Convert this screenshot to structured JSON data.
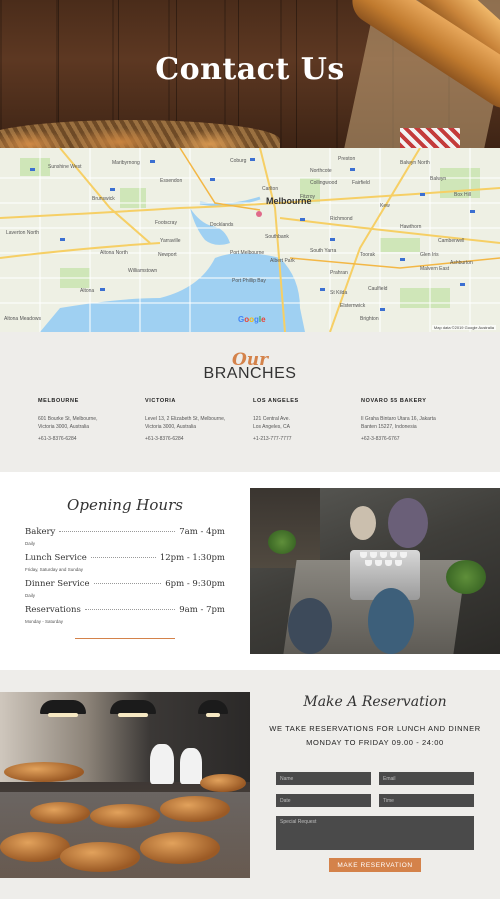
{
  "hero": {
    "title": "Contact Us"
  },
  "map": {
    "logo_letters": [
      "G",
      "o",
      "o",
      "g",
      "l",
      "e"
    ],
    "attribution": "Map data ©2019 Google   Australia",
    "city_label": "Melbourne",
    "labels": [
      "Sunshine West",
      "Maribyrnong",
      "Brunswick",
      "Northcote",
      "Fairfield",
      "Balwyn",
      "Kew",
      "Hawthorn",
      "Camberwell",
      "Richmond",
      "South Yarra",
      "Prahran",
      "St Kilda",
      "Brighton",
      "Williamstown",
      "Newport",
      "Altona North",
      "Footscray",
      "Port Melbourne",
      "Southbank",
      "Carlton",
      "Fitzroy",
      "Collingwood",
      "Toorak",
      "Malvern East",
      "Elsternwick",
      "Caulfield",
      "Glen Iris",
      "Ashburton",
      "Preston",
      "Coburg",
      "Essendon",
      "Yarraville",
      "Docklands",
      "Albert Park",
      "Port Phillip Bay",
      "Altona",
      "Laverton North",
      "Altona Meadows",
      "Balwyn North",
      "Box Hill"
    ]
  },
  "branches": {
    "heading_script": "Our",
    "heading_word": "BRANCHES",
    "items": [
      {
        "name": "MELBOURNE",
        "address_1": "601 Bourke St, Melbourne,",
        "address_2": "Victoria 3000, Australia",
        "phone": "+61-3-8376-6284"
      },
      {
        "name": "VICTORIA",
        "address_1": "Level 13, 2 Elizabeth St, Melbourne,",
        "address_2": "Victoria 3000, Australia",
        "phone": "+61-3-8376-6284"
      },
      {
        "name": "LOS ANGELES",
        "address_1": "121 Central Ave.",
        "address_2": "Los Angeles, CA",
        "phone": "+1-213-777-7777"
      },
      {
        "name": "NOVARO 55 BAKERY",
        "address_1": "Il Graha Bintaro Utara 16, Jakarta",
        "address_2": "Banten 15227, Indonesia",
        "phone": "+62-3-8376-6767"
      }
    ]
  },
  "hours": {
    "title": "Opening Hours",
    "rows": [
      {
        "label": "Bakery",
        "time": "7am - 4pm",
        "note": "Daily"
      },
      {
        "label": "Lunch Service",
        "time": "12pm - 1:30pm",
        "note": "Friday, Saturday and Sunday"
      },
      {
        "label": "Dinner Service",
        "time": "6pm - 9:30pm",
        "note": "Daily"
      },
      {
        "label": "Reservations",
        "time": "9am - 7pm",
        "note": "Monday - Saturday"
      }
    ]
  },
  "reservation": {
    "title": "Make A Reservation",
    "line1": "WE TAKE RESERVATIONS FOR LUNCH AND DINNER",
    "line2": "MONDAY TO FRIDAY 09.00 - 24:00",
    "placeholders": {
      "name": "Name",
      "email": "Email",
      "date": "Date",
      "time": "Time",
      "special": "Special Request"
    },
    "button": "MAKE RESERVATION"
  },
  "colors": {
    "accent": "#d4824a",
    "section_bg": "#eeedea",
    "field_bg": "#4a4a4a"
  }
}
